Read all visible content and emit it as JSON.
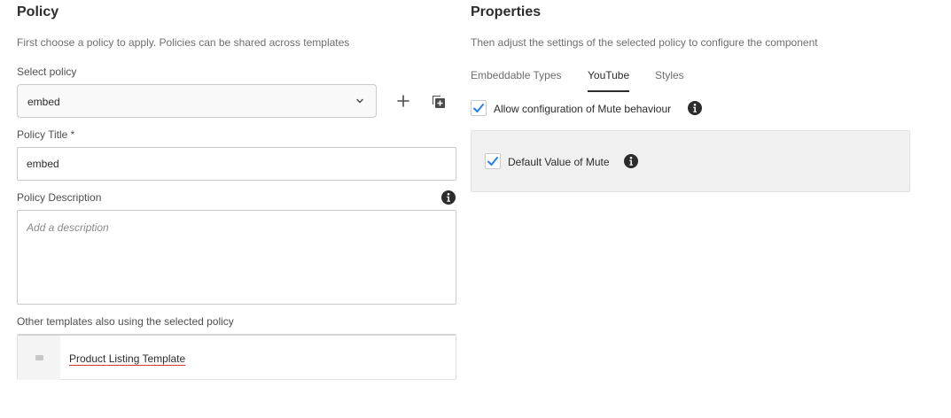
{
  "policy": {
    "heading": "Policy",
    "subtext": "First choose a policy to apply. Policies can be shared across templates",
    "select_label": "Select policy",
    "select_value": "embed",
    "title_label": "Policy Title *",
    "title_value": "embed",
    "description_label": "Policy Description",
    "description_placeholder": "Add a description",
    "templates_label": "Other templates also using the selected policy",
    "templates": [
      {
        "name": "Product Listing Template"
      }
    ]
  },
  "properties": {
    "heading": "Properties",
    "subtext": "Then adjust the settings of the selected policy to configure the component",
    "tabs": [
      {
        "label": "Embeddable Types",
        "active": false
      },
      {
        "label": "YouTube",
        "active": true
      },
      {
        "label": "Styles",
        "active": false
      }
    ],
    "allow_mute": {
      "label": "Allow configuration of Mute behaviour",
      "checked": true
    },
    "default_mute": {
      "label": "Default Value of Mute",
      "checked": true
    }
  },
  "colors": {
    "accent": "#2680eb",
    "link_underline": "#d7373f",
    "panel_bg": "#f0f0f0"
  },
  "icons": {
    "add": "plus-icon",
    "duplicate": "duplicate-icon",
    "info": "info-icon",
    "dropdown": "chevron-down-icon",
    "template": "template-thumbnail-icon"
  }
}
